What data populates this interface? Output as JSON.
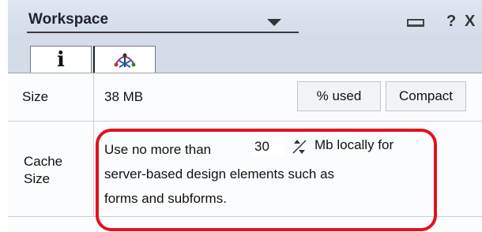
{
  "header": {
    "title": "Workspace",
    "help_label": "?",
    "close_label": "X"
  },
  "tabs": [
    {
      "label": "i",
      "icon": "info-icon"
    },
    {
      "label": "",
      "icon": "database-icon"
    }
  ],
  "size_row": {
    "label": "Size",
    "value": "38 MB",
    "used_button": "% used",
    "compact_button": "Compact"
  },
  "cache_row": {
    "label_line1": "Cache",
    "label_line2": "Size",
    "prefix": "Use no more than",
    "value": "30",
    "unit_suffix": "Mb locally for",
    "line2": "server-based design elements such as",
    "line3": "forms and subforms."
  },
  "colors": {
    "highlight": "#e1131d",
    "header_bg": "#d2dbe8"
  }
}
